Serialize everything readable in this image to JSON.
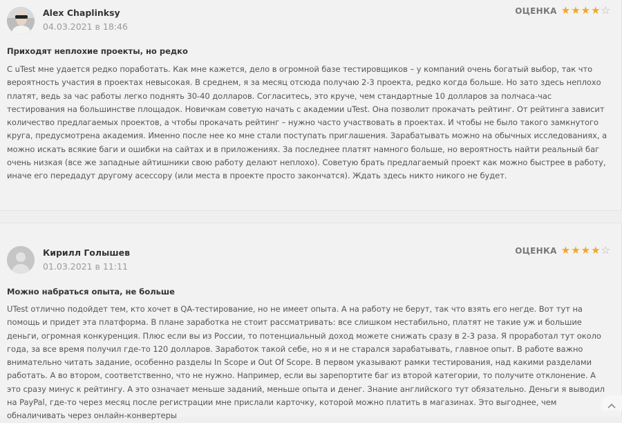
{
  "reviews": [
    {
      "author": "Alex Chaplinksy",
      "date": "04.03.2021 в 18:46",
      "rating_label": "ОЦЕНКА",
      "rating": 4,
      "rating_max": 5,
      "title": "Приходят неплохие проекты, но редко",
      "body": "С uTest мне удается редко поработать. Как мне кажется, дело в огромной базе тестировщиков – у компаний очень богатый выбор, так что вероятность участия в проектах невысокая. В среднем, я за месяц отсюда получаю 2-3 проекта, редко когда больше. Но зато здесь неплохо платят, ведь за час работы легко поднять 30-40 долларов. Согласитесь, это круче, чем стандартные 10 долларов за полчаса-час тестирования на большинстве площадок. Новичкам советую начать с академии uTest. Она позволит прокачать рейтинг. От рейтинга зависит количество предлагаемых проектов, а чтобы прокачать рейтинг – нужно часто участвовать в проектах. И чтобы не было такого замкнутого круга, предусмотрена академия. Именно после нее ко мне стали поступать приглашения. Зарабатывать можно на обычных исследованиях, а можно искать всякие баги и ошибки на сайтах и в приложениях. За последнее платят намного больше, но вероятность найти реальный баг очень низкая (все же западные айтишники свою работу делают неплохо). Советую брать предлагаемый проект как можно быстрее в работу, иначе его передадут другому асессору (или места в проекте просто закончатся). Ждать здесь никто никого не будет."
    },
    {
      "author": "Кирилл Голышев",
      "date": "01.03.2021 в 11:11",
      "rating_label": "ОЦЕНКА",
      "rating": 4,
      "rating_max": 5,
      "title": "Можно набраться опыта, не больше",
      "body": "UTest отлично подойдет тем, кто хочет в QA-тестирование, но не имеет опыта. А на работу не берут, так что взять его негде. Вот тут на помощь и придет эта платформа. В плане заработка не стоит рассматривать: все слишком нестабильно, платят не такие уж и большие деньги, огромная конкуренция. Плюс если вы из России, то потенциальный доход можете снижать сразу в 2-3 раза. Я проработал тут около года, за все время получил где-то 120 долларов. Заработок такой себе, но я и не старался зарабатывать, главное опыт. В работе важно внимательно читать задание, особенно разделы In Scope и Out Of Scope. В первом указывают рамки тестирования, над какими разделами работать. А во втором, соответственно, что не нужно. Например, если вы зарепортите баг из второй категории, то получите отклонение. А это сразу минус к рейтингу. А это означает меньше заданий, меньше опыта и денег. Знание английского тут обязательно. Деньги я выводил на PayPal, где-то через месяц после регистрации мне прислали карточку, которой можно платить в магазинах. Это выгоднее, чем обналичивать через онлайн-конвертеры"
    }
  ],
  "icons": {
    "star_full": "★",
    "star_empty": "☆",
    "scroll_up": "chevron-up-icon"
  },
  "colors": {
    "star": "#f3a722",
    "star_empty": "#b3b3b3",
    "background": "#f2f2f2"
  }
}
